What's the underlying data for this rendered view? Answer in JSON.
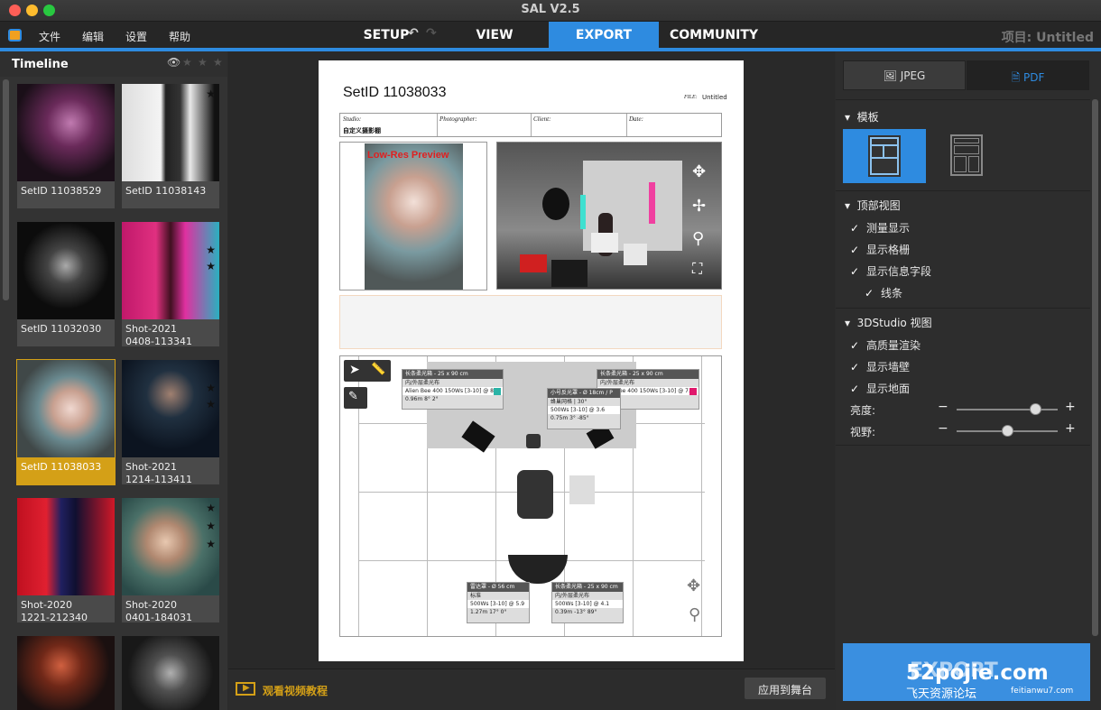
{
  "app": {
    "title": "SAL V2.5",
    "project": "项目: Untitled"
  },
  "menu": [
    "文件",
    "编辑",
    "设置",
    "帮助"
  ],
  "tabs": {
    "setup": "SETUP",
    "view": "VIEW",
    "export": "EXPORT",
    "community": "COMMUNITY"
  },
  "timeline": {
    "title": "Timeline",
    "items": [
      {
        "caption": "SetID 11038529"
      },
      {
        "caption": "SetID 11038143"
      },
      {
        "caption": "SetID 11032030"
      },
      {
        "caption": "Shot-2021\n0408-113341"
      },
      {
        "caption": "SetID 11038033"
      },
      {
        "caption": "Shot-2021\n1214-113411"
      },
      {
        "caption": "Shot-2020\n1221-212340"
      },
      {
        "caption": "Shot-2020\n0401-184031"
      },
      {
        "caption": ""
      },
      {
        "caption": ""
      }
    ]
  },
  "doc": {
    "setid": "SetID 11038033",
    "file_label": "FILE:",
    "file_value": "Untitled",
    "fields": {
      "studio": "Studio:",
      "studio_value": "自定义摄影棚",
      "photographer": "Photographer:",
      "client": "Client:",
      "date": "Date:"
    },
    "preview_label": "Low-Res Preview",
    "lights": [
      {
        "title": "长条柔光箱 - 25 x 90 cm",
        "sub": "内/外层柔光布",
        "power": "Alien Bee 400 150Ws [3-10] @ 8.0",
        "geo": "0.96m  8°  2°",
        "color": "#2ab3a6"
      },
      {
        "title": "长条柔光箱 - 25 x 90 cm",
        "sub": "内/外层柔光布",
        "power": "Alien Bee 400 150Ws [3-10] @ 7.6",
        "geo": "7°  1°",
        "color": "#e0186c"
      },
      {
        "title": "小号反光罩 - Ø 18cm / P 13cm",
        "sub": "蜂巢网格 | 30°",
        "power": "500Ws [3-10] @ 3.6",
        "geo": "0.75m  3°  -85°",
        "color": "#ffffff"
      },
      {
        "title": "雷达罩 - Ø 56 cm",
        "sub": "标准",
        "power": "500Ws [3-10] @ 5.9",
        "geo": "1.27m  17°  0°",
        "color": "#ffffff"
      },
      {
        "title": "长条柔光箱 - 25 x 90 cm",
        "sub": "内/外层柔光布",
        "power": "500Ws [3-10] @ 4.1",
        "geo": "0.39m  -13°  89°",
        "color": "#ffffff"
      }
    ]
  },
  "bottom": {
    "tutorial": "观看视频教程",
    "apply": "应用到舞台"
  },
  "right": {
    "jpeg": "JPEG",
    "pdf": "PDF",
    "template_title": "模板",
    "top_view_title": "顶部视图",
    "top_view_opts": [
      "测量显示",
      "显示格栅",
      "显示信息字段",
      "线条"
    ],
    "studio_title": "3DStudio 视图",
    "studio_opts": [
      "高质量渲染",
      "显示墙壁",
      "显示地面"
    ],
    "brightness_label": "亮度:",
    "fov_label": "视野:",
    "brightness_value": 0.78,
    "fov_value": 0.5,
    "export_button": "EXPORT"
  },
  "watermark": {
    "line1": "52pojie.com",
    "line2": "飞天资源论坛",
    "line3": "feitianwu7.com"
  },
  "colors": {
    "accent": "#2e8be0",
    "selected": "#d4a017"
  }
}
